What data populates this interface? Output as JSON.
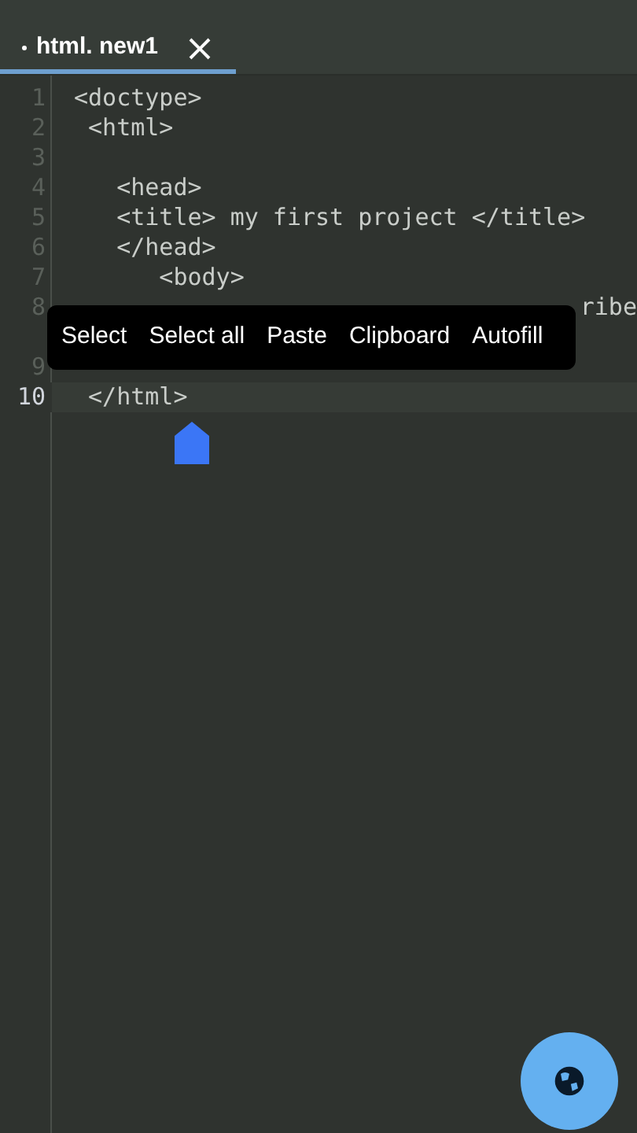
{
  "tabs": [
    {
      "label": "html. new1",
      "modified": true,
      "selected": true
    }
  ],
  "lines": [
    {
      "number": "1",
      "code": "<doctype>",
      "current": false
    },
    {
      "number": "2",
      "code": " <html>",
      "current": false
    },
    {
      "number": "3",
      "current": false
    },
    {
      "number": "4",
      "code": "   <head>",
      "current": false
    },
    {
      "number": "5",
      "code": "   <title> my first project </title>",
      "current": false
    },
    {
      "number": "6",
      "code": "   </head>",
      "current": false
    },
    {
      "number": "7",
      "code": "      <body>",
      "current": false
    },
    {
      "number": "8",
      "code": "ribe",
      "kind": "tail",
      "current": false
    },
    {
      "number": "9",
      "current": false
    },
    {
      "number": "10",
      "code": " </html>",
      "current": true
    }
  ],
  "context_menu": [
    "Select",
    "Select all",
    "Paste",
    "Clipboard",
    "Autofill"
  ]
}
